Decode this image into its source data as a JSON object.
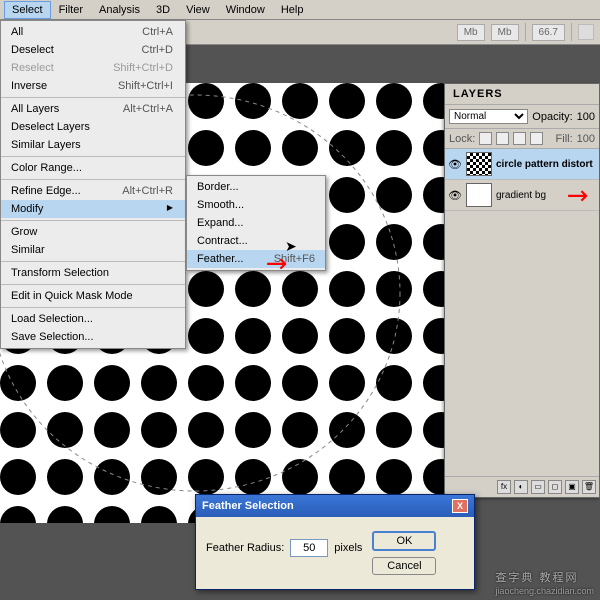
{
  "menubar": [
    "Select",
    "Filter",
    "Analysis",
    "3D",
    "View",
    "Window",
    "Help"
  ],
  "menubar_active_index": 0,
  "toolbar": {
    "zoom": "66.7",
    "icons": [
      "Mb",
      "Mb",
      "⊞",
      "⊟",
      "▦"
    ]
  },
  "dropdown": [
    {
      "label": "All",
      "accel": "Ctrl+A"
    },
    {
      "label": "Deselect",
      "accel": "Ctrl+D"
    },
    {
      "label": "Reselect",
      "accel": "Shift+Ctrl+D",
      "disabled": true
    },
    {
      "label": "Inverse",
      "accel": "Shift+Ctrl+I"
    },
    {
      "sep": true
    },
    {
      "label": "All Layers",
      "accel": "Alt+Ctrl+A"
    },
    {
      "label": "Deselect Layers",
      "accel": ""
    },
    {
      "label": "Similar Layers",
      "accel": ""
    },
    {
      "sep": true
    },
    {
      "label": "Color Range...",
      "accel": ""
    },
    {
      "sep": true
    },
    {
      "label": "Refine Edge...",
      "accel": "Alt+Ctrl+R"
    },
    {
      "label": "Modify",
      "accel": "",
      "sub": true,
      "highlight": true
    },
    {
      "sep": true
    },
    {
      "label": "Grow",
      "accel": ""
    },
    {
      "label": "Similar",
      "accel": ""
    },
    {
      "sep": true
    },
    {
      "label": "Transform Selection",
      "accel": ""
    },
    {
      "sep": true
    },
    {
      "label": "Edit in Quick Mask Mode",
      "accel": ""
    },
    {
      "sep": true
    },
    {
      "label": "Load Selection...",
      "accel": ""
    },
    {
      "label": "Save Selection...",
      "accel": ""
    }
  ],
  "submenu": [
    {
      "label": "Border..."
    },
    {
      "label": "Smooth..."
    },
    {
      "label": "Expand..."
    },
    {
      "label": "Contract..."
    },
    {
      "label": "Feather...",
      "accel": "Shift+F6",
      "highlight": true
    }
  ],
  "layers": {
    "tab": "LAYERS",
    "mode": "Normal",
    "opacity_label": "Opacity:",
    "opacity": "100",
    "lock_label": "Lock:",
    "fill_label": "Fill:",
    "fill": "100",
    "rows": [
      {
        "name": "circle pattern distort",
        "selected": true,
        "thumb": "pattern",
        "bold": true
      },
      {
        "name": "gradient bg",
        "selected": false,
        "thumb": "white",
        "bold": false
      }
    ],
    "footer_icons": [
      "fx",
      "◐",
      "▭",
      "◻",
      "▣",
      "🗑"
    ]
  },
  "dialog": {
    "title": "Feather Selection",
    "field_label": "Feather Radius:",
    "value": "50",
    "unit": "pixels",
    "ok": "OK",
    "cancel": "Cancel"
  },
  "watermark": {
    "big": "查字典 教程网",
    "small": "jiaocheng.chazidian.com"
  }
}
